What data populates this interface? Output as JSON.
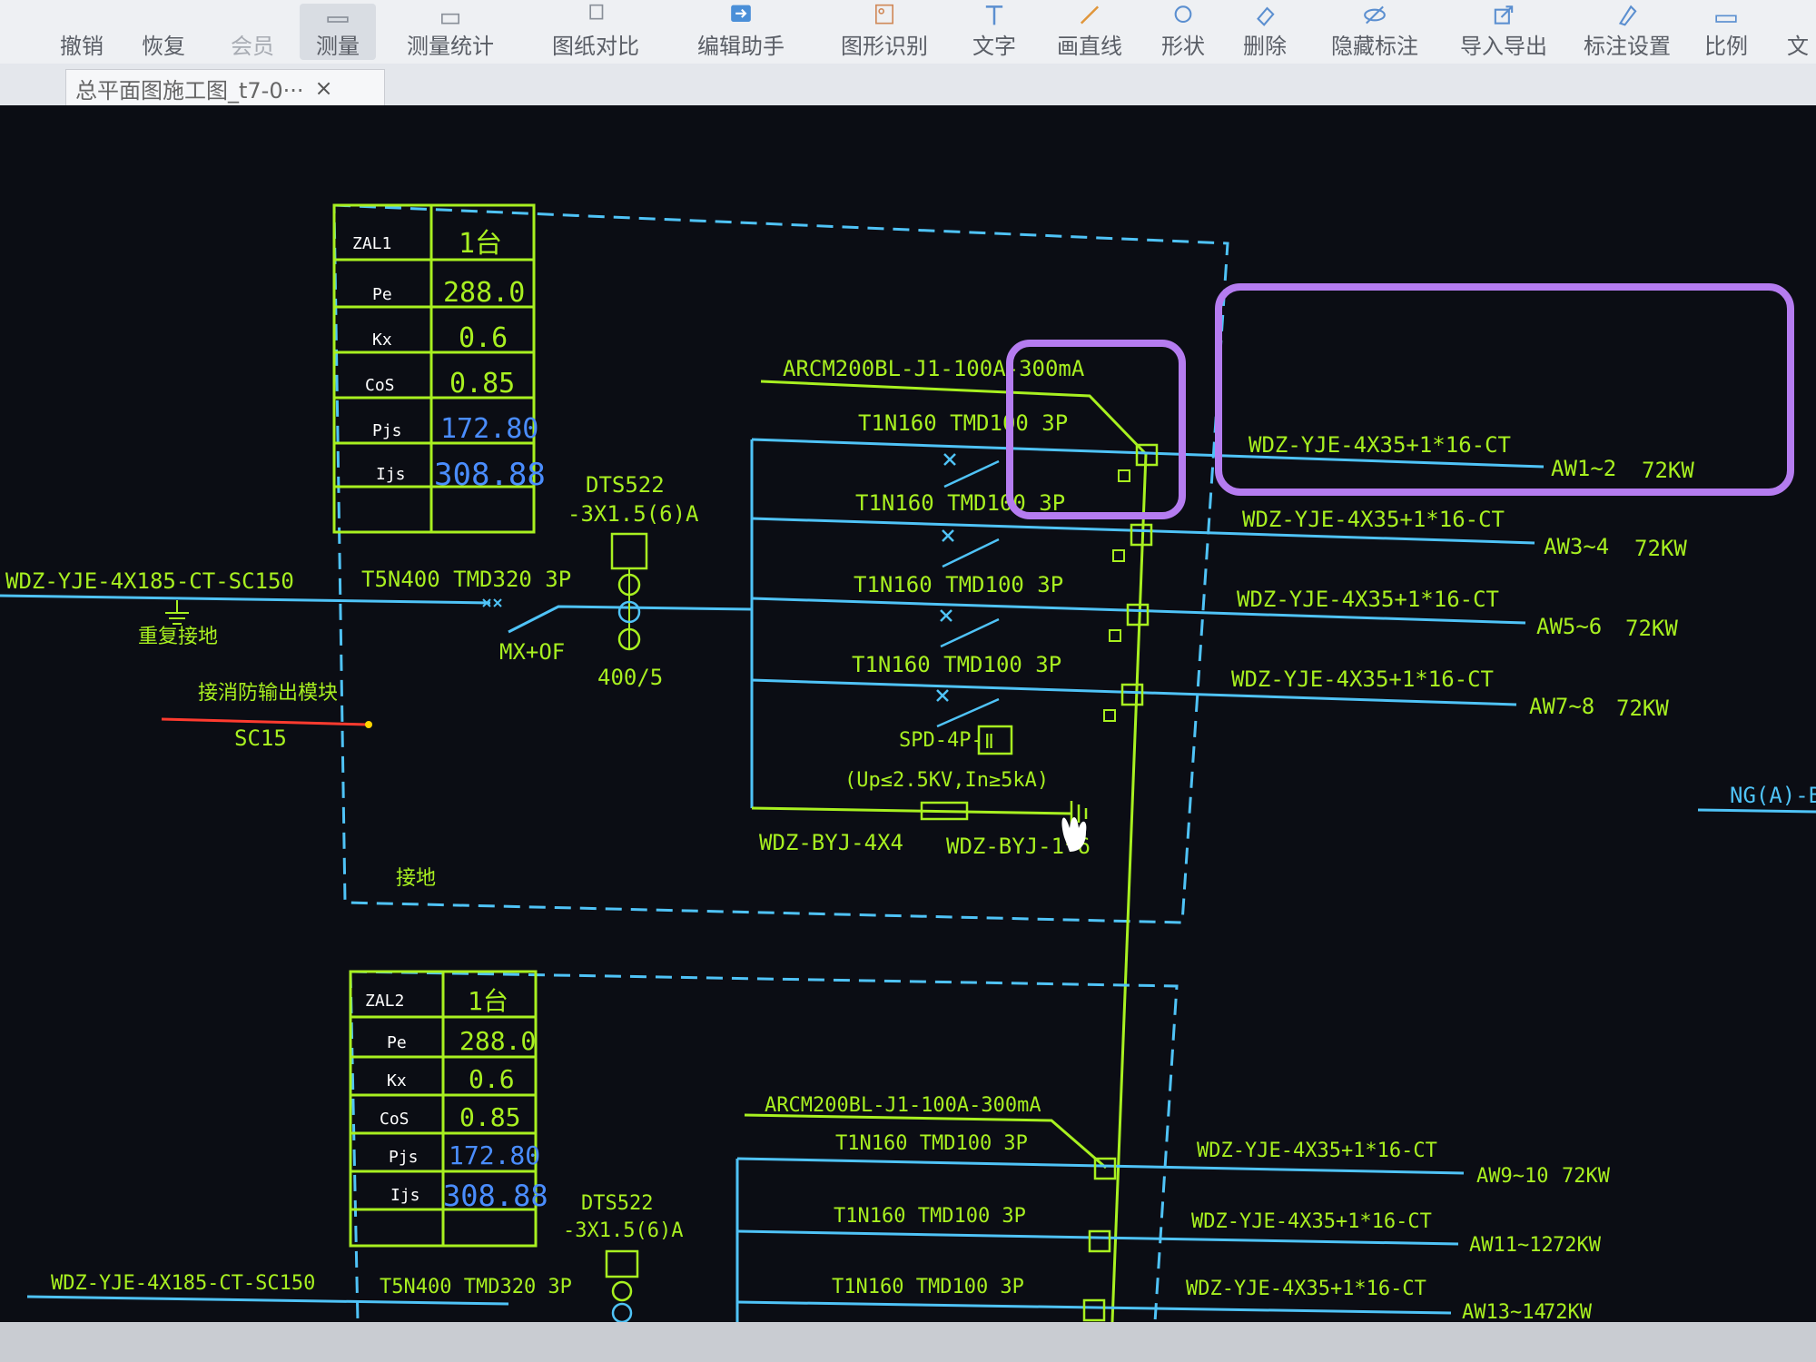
{
  "toolbar": {
    "items": [
      {
        "label": "撤销",
        "icon": "undo-icon"
      },
      {
        "label": "恢复",
        "icon": "redo-icon"
      },
      {
        "label": "会员",
        "icon": "member-icon"
      },
      {
        "label": "测量",
        "icon": "measure-icon"
      },
      {
        "label": "测量统计",
        "icon": "measure-stats-icon"
      },
      {
        "label": "图纸对比",
        "icon": "compare-icon"
      },
      {
        "label": "编辑助手",
        "icon": "edit-assistant-icon"
      },
      {
        "label": "图形识别",
        "icon": "shape-recognition-icon"
      },
      {
        "label": "文字",
        "icon": "text-icon"
      },
      {
        "label": "画直线",
        "icon": "line-icon"
      },
      {
        "label": "形状",
        "icon": "shape-icon"
      },
      {
        "label": "删除",
        "icon": "eraser-icon"
      },
      {
        "label": "隐藏标注",
        "icon": "hide-annotation-icon"
      },
      {
        "label": "导入导出",
        "icon": "import-export-icon"
      },
      {
        "label": "标注设置",
        "icon": "annotation-settings-icon"
      },
      {
        "label": "比例",
        "icon": "scale-icon"
      },
      {
        "label": "文",
        "icon": "text2-icon"
      }
    ]
  },
  "tabs": {
    "closeall": "×",
    "active_tab": "总平面图施工图_t7-0···",
    "close": "×"
  },
  "drawing": {
    "panel1": {
      "table": [
        {
          "k": "ZAL1",
          "v": "1台"
        },
        {
          "k": "Pe",
          "v": "288.0"
        },
        {
          "k": "Kx",
          "v": "0.6"
        },
        {
          "k": "CoS",
          "v": "0.85"
        },
        {
          "k": "Pjs",
          "v": "172.80"
        },
        {
          "k": "Ijs",
          "v": "308.88"
        }
      ],
      "incoming_cable": "WDZ-YJE-4X185-CT-SC150",
      "ground_note": "重复接地",
      "fire_link": "接消防输出模块",
      "fire_cable": "SC15",
      "main_breaker": "T5N400  TMD320 3P",
      "mx_of": "MX+OF",
      "meter": "DTS522",
      "meter_spec": "-3X1.5(6)A",
      "ct": "400/5",
      "rcd": "ARCM200BL-J1-100A-300mA",
      "breaker": "T1N160  TMD100 3P",
      "spd": "SPD-4P-",
      "spd_box": "Ⅱ",
      "spd_spec": "(Up≤2.5KV,In≥5kA)",
      "spd_cable": "WDZ-BYJ-4X4",
      "pe_cable": "WDZ-BYJ-1*6",
      "ground_label": "接地",
      "feeders": [
        {
          "cable": "WDZ-YJE-4X35+1*16-CT",
          "label": "AW1~2",
          "power": "72KW"
        },
        {
          "cable": "WDZ-YJE-4X35+1*16-CT",
          "label": "AW3~4",
          "power": "72KW"
        },
        {
          "cable": "WDZ-YJE-4X35+1*16-CT",
          "label": "AW5~6",
          "power": "72KW"
        },
        {
          "cable": "WDZ-YJE-4X35+1*16-CT",
          "label": "AW7~8",
          "power": "72KW"
        }
      ],
      "side_label": "NG(A)-BTL"
    },
    "panel2": {
      "table": [
        {
          "k": "ZAL2",
          "v": "1台"
        },
        {
          "k": "Pe",
          "v": "288.0"
        },
        {
          "k": "Kx",
          "v": "0.6"
        },
        {
          "k": "CoS",
          "v": "0.85"
        },
        {
          "k": "Pjs",
          "v": "172.80"
        },
        {
          "k": "Ijs",
          "v": "308.88"
        }
      ],
      "incoming_cable": "WDZ-YJE-4X185-CT-SC150",
      "main_breaker": "T5N400  TMD320 3P",
      "meter": "DTS522",
      "meter_spec": "-3X1.5(6)A",
      "rcd": "ARCM200BL-J1-100A-300mA",
      "breaker": "T1N160  TMD100 3P",
      "feeders": [
        {
          "cable": "WDZ-YJE-4X35+1*16-CT",
          "label": "AW9~10",
          "power": "72KW"
        },
        {
          "cable": "WDZ-YJE-4X35+1*16-CT",
          "label": "AW11~12",
          "power": "72KW"
        },
        {
          "cable": "WDZ-YJE-4X35+1*16-CT",
          "label": "AW13~14",
          "power": "72KW"
        }
      ]
    }
  },
  "colors": {
    "cad_green": "#a8f020",
    "cad_cyan": "#4fc3f7",
    "cad_blue_value": "#3d6cff",
    "cad_red": "#ff3b2f",
    "highlight": "#b57cf0"
  }
}
